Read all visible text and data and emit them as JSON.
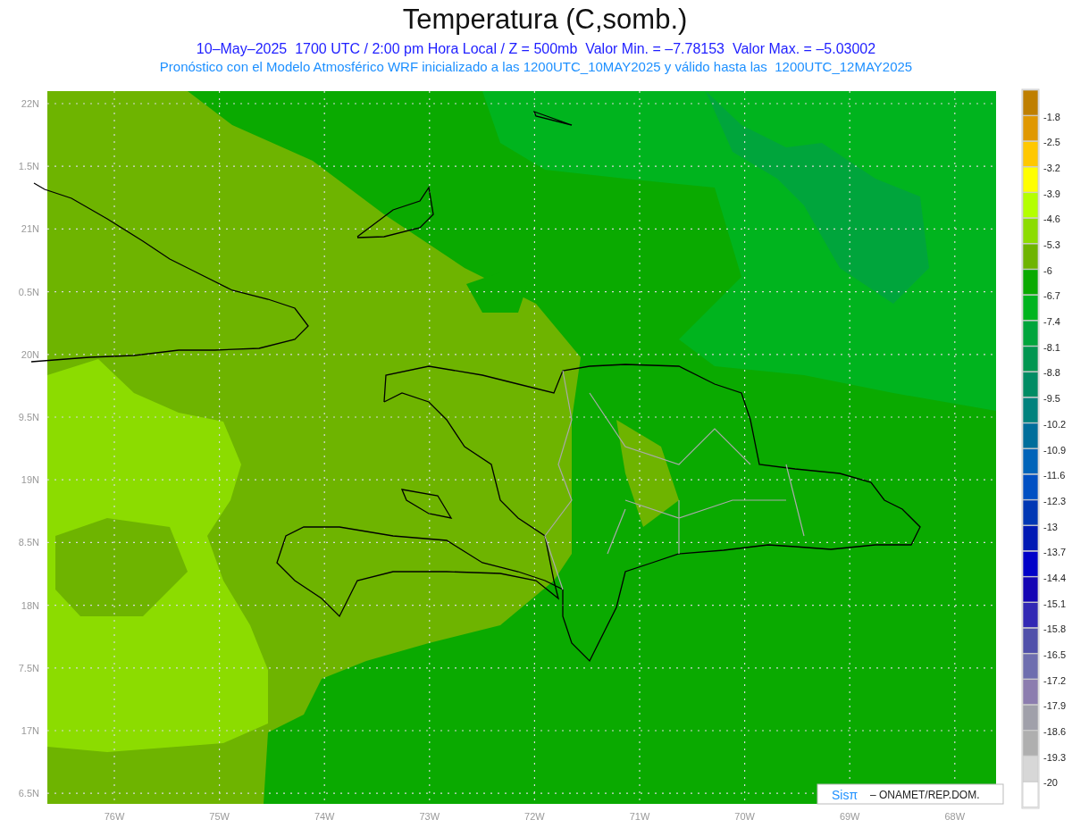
{
  "title": "Temperatura (C,somb.)",
  "subtitle": "10–May–2025  1700 UTC / 2:00 pm Hora Local / Z = 500mb  Valor Min. = –7.78153  Valor Max. = –5.03002",
  "caption": "Pronóstico con el Modelo Atmosférico WRF inicializado a las 1200UTC_10MAY2025 y válido hasta las  1200UTC_12MAY2025",
  "map": {
    "lat_labels": [
      "22N",
      "1.5N",
      "21N",
      "0.5N",
      "20N",
      "9.5N",
      "19N",
      "8.5N",
      "18N",
      "7.5N",
      "17N",
      "6.5N"
    ],
    "lon_labels": [
      "76W",
      "75W",
      "74W",
      "73W",
      "72W",
      "71W",
      "70W",
      "69W",
      "68W"
    ],
    "credit": {
      "logo": "Sisπ",
      "text": "– ONAMET/REP.DOM."
    }
  },
  "colorbar": {
    "bins": [
      {
        "color": "#bf7f00"
      },
      {
        "color": "#e09800"
      },
      {
        "color": "#ffc800"
      },
      {
        "color": "#ffff00"
      },
      {
        "color": "#b4ff00"
      },
      {
        "color": "#8cdc00"
      },
      {
        "color": "#6eb400"
      },
      {
        "color": "#0aaa00"
      },
      {
        "color": "#00b41e"
      },
      {
        "color": "#00a53c"
      },
      {
        "color": "#009650"
      },
      {
        "color": "#008c64"
      },
      {
        "color": "#00827d"
      },
      {
        "color": "#006e9b"
      },
      {
        "color": "#0064b9"
      },
      {
        "color": "#0050c3"
      },
      {
        "color": "#0037b4"
      },
      {
        "color": "#0019b4"
      },
      {
        "color": "#0000c8"
      },
      {
        "color": "#1405b4"
      },
      {
        "color": "#3228b4"
      },
      {
        "color": "#5050aa"
      },
      {
        "color": "#6e6eaf"
      },
      {
        "color": "#8c7daf"
      },
      {
        "color": "#a0a0aa"
      },
      {
        "color": "#afafaf"
      },
      {
        "color": "#d7d7d7"
      },
      {
        "color": "#ffffff"
      }
    ],
    "labels": [
      "-1.8",
      "-2.5",
      "-3.2",
      "-3.9",
      "-4.6",
      "-5.3",
      "-6",
      "-6.7",
      "-7.4",
      "-8.1",
      "-8.8",
      "-9.5",
      "-10.2",
      "-10.9",
      "-11.6",
      "-12.3",
      "-13",
      "-13.7",
      "-14.4",
      "-15.1",
      "-15.8",
      "-16.5",
      "-17.2",
      "-17.9",
      "-18.6",
      "-19.3",
      "-20"
    ]
  }
}
